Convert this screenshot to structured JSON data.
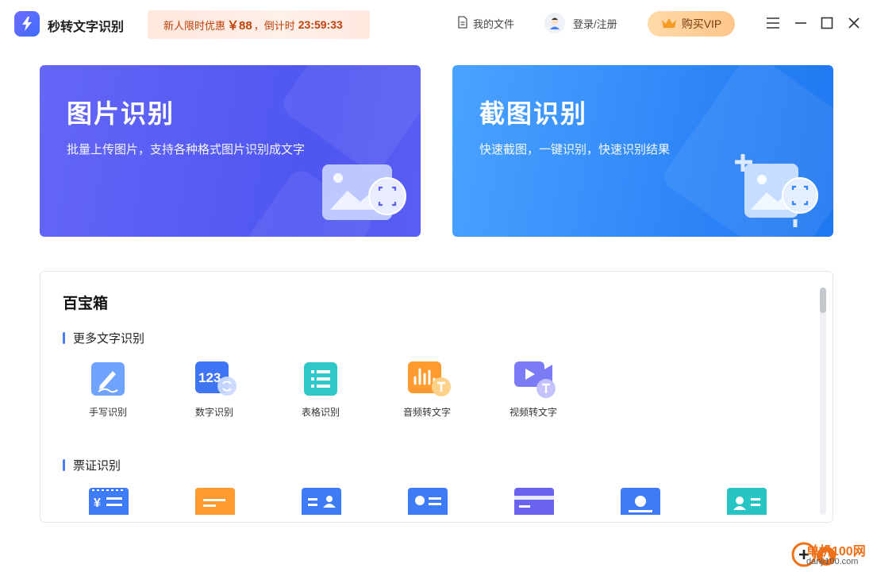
{
  "app": {
    "title": "秒转文字识别"
  },
  "promo": {
    "prefix": "新人限时优惠",
    "price": "￥88",
    "countdown_label": "，倒计时",
    "countdown": "23:59:33"
  },
  "header": {
    "my_files": "我的文件",
    "login": "登录/注册",
    "buy_vip": "购买VIP"
  },
  "cards": [
    {
      "title": "图片识别",
      "desc": "批量上传图片，支持各种格式图片识别成文字"
    },
    {
      "title": "截图识别",
      "desc": "快速截图，一键识别，快速识别结果"
    }
  ],
  "toolbox": {
    "title": "百宝箱",
    "sections": [
      {
        "title": "更多文字识别",
        "tools": [
          {
            "label": "手写识别",
            "icon": "handwriting-icon"
          },
          {
            "label": "数字识别",
            "icon": "number-icon"
          },
          {
            "label": "表格识别",
            "icon": "table-icon"
          },
          {
            "label": "音频转文字",
            "icon": "audio-icon"
          },
          {
            "label": "视频转文字",
            "icon": "video-icon"
          }
        ]
      },
      {
        "title": "票证识别",
        "tools": [
          {
            "icon": "invoice-icon"
          },
          {
            "icon": "ticket-icon"
          },
          {
            "icon": "id-card-icon"
          },
          {
            "icon": "id-card-back-icon"
          },
          {
            "icon": "bank-card-icon"
          },
          {
            "icon": "certificate-icon"
          },
          {
            "icon": "business-card-icon"
          }
        ]
      }
    ]
  },
  "watermark": {
    "name": "单机100网",
    "url": "danji100.com"
  },
  "colors": {
    "accent": "#4a7dff",
    "card_left": "#5a5ef3",
    "card_right": "#2f86f8",
    "promo_text": "#c2410c"
  }
}
